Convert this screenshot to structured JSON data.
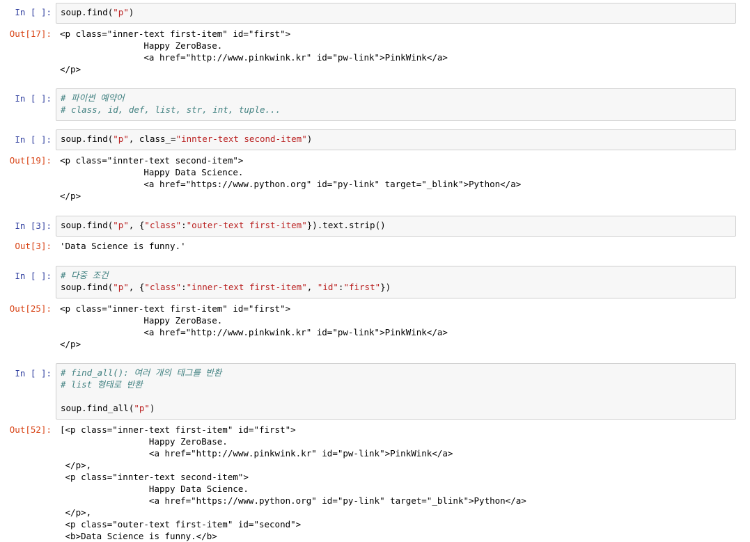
{
  "cells": [
    {
      "in_prompt": "In [ ]:",
      "code": [
        [
          {
            "t": "soup.find("
          },
          {
            "t": "\"p\"",
            "c": "str"
          },
          {
            "t": ")"
          }
        ]
      ],
      "out_prompt": "Out[17]:",
      "output": [
        "<p class=\"inner-text first-item\" id=\"first\">",
        "                Happy ZeroBase.",
        "                <a href=\"http://www.pinkwink.kr\" id=\"pw-link\">PinkWink</a>",
        "</p>"
      ]
    },
    {
      "in_prompt": "In [ ]:",
      "code": [
        [
          {
            "t": "# 파이썬 예약어",
            "c": "cmt"
          }
        ],
        [
          {
            "t": "# class, id, def, list, str, int, tuple...",
            "c": "cmt"
          }
        ]
      ]
    },
    {
      "in_prompt": "In [ ]:",
      "code": [
        [
          {
            "t": "soup.find("
          },
          {
            "t": "\"p\"",
            "c": "str"
          },
          {
            "t": ", class_="
          },
          {
            "t": "\"innter-text second-item\"",
            "c": "str"
          },
          {
            "t": ")"
          }
        ]
      ],
      "out_prompt": "Out[19]:",
      "output": [
        "<p class=\"innter-text second-item\">",
        "                Happy Data Science.",
        "                <a href=\"https://www.python.org\" id=\"py-link\" target=\"_blink\">Python</a>",
        "</p>"
      ]
    },
    {
      "in_prompt": "In [3]:",
      "code": [
        [
          {
            "t": "soup.find("
          },
          {
            "t": "\"p\"",
            "c": "str"
          },
          {
            "t": ", {"
          },
          {
            "t": "\"class\"",
            "c": "str"
          },
          {
            "t": ":"
          },
          {
            "t": "\"outer-text first-item\"",
            "c": "str"
          },
          {
            "t": "}).text.strip()"
          }
        ]
      ],
      "out_prompt": "Out[3]:",
      "output": [
        "'Data Science is funny.'"
      ]
    },
    {
      "in_prompt": "In [ ]:",
      "code": [
        [
          {
            "t": "# 다중 조건",
            "c": "cmt"
          }
        ],
        [
          {
            "t": "soup.find("
          },
          {
            "t": "\"p\"",
            "c": "str"
          },
          {
            "t": ", {"
          },
          {
            "t": "\"class\"",
            "c": "str"
          },
          {
            "t": ":"
          },
          {
            "t": "\"inner-text first-item\"",
            "c": "str"
          },
          {
            "t": ", "
          },
          {
            "t": "\"id\"",
            "c": "str"
          },
          {
            "t": ":"
          },
          {
            "t": "\"first\"",
            "c": "str"
          },
          {
            "t": "})"
          }
        ]
      ],
      "out_prompt": "Out[25]:",
      "output": [
        "<p class=\"inner-text first-item\" id=\"first\">",
        "                Happy ZeroBase.",
        "                <a href=\"http://www.pinkwink.kr\" id=\"pw-link\">PinkWink</a>",
        "</p>"
      ]
    },
    {
      "in_prompt": "In [ ]:",
      "code": [
        [
          {
            "t": "# find_all(): 여러 개의 태그를 반환",
            "c": "cmt"
          }
        ],
        [
          {
            "t": "# list 형태로 반환",
            "c": "cmt"
          }
        ],
        [
          {
            "t": ""
          }
        ],
        [
          {
            "t": "soup.find_all("
          },
          {
            "t": "\"p\"",
            "c": "str"
          },
          {
            "t": ")"
          }
        ]
      ],
      "out_prompt": "Out[52]:",
      "output": [
        "[<p class=\"inner-text first-item\" id=\"first\">",
        "                 Happy ZeroBase.",
        "                 <a href=\"http://www.pinkwink.kr\" id=\"pw-link\">PinkWink</a>",
        " </p>,",
        " <p class=\"innter-text second-item\">",
        "                 Happy Data Science.",
        "                 <a href=\"https://www.python.org\" id=\"py-link\" target=\"_blink\">Python</a>",
        " </p>,",
        " <p class=\"outer-text first-item\" id=\"second\">",
        " <b>Data Science is funny.</b>"
      ]
    }
  ]
}
